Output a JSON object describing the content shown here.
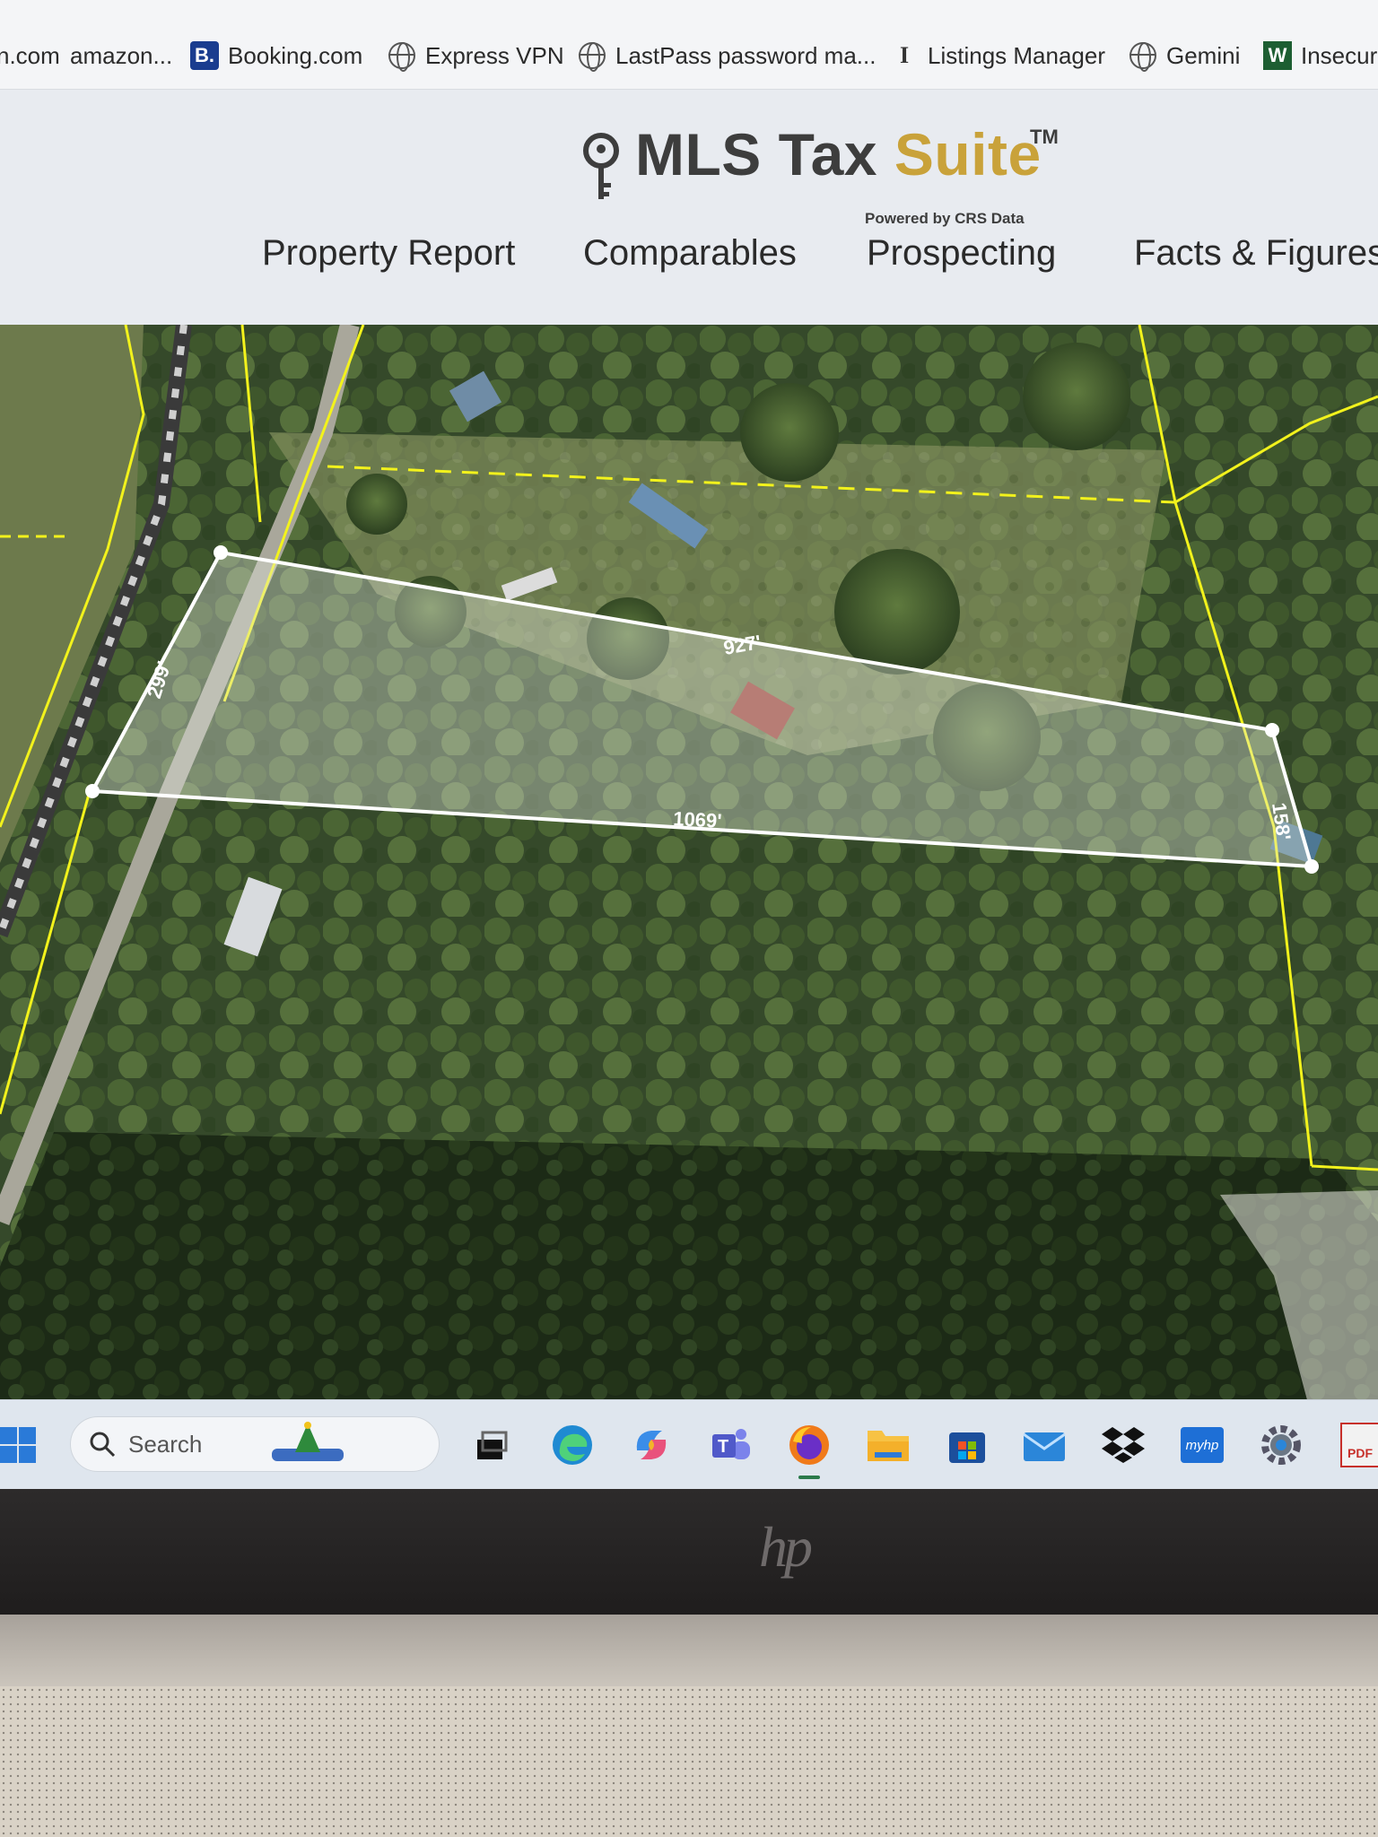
{
  "bookmarks": [
    {
      "label": "n.com",
      "icon": "none"
    },
    {
      "label": "amazon...",
      "icon": "none"
    },
    {
      "label": "Booking.com",
      "icon": "booking-icon",
      "glyph": "B."
    },
    {
      "label": "Express VPN",
      "icon": "globe-icon"
    },
    {
      "label": "LastPass password ma...",
      "icon": "globe-icon"
    },
    {
      "label": "Listings Manager",
      "icon": "listings-manager-icon",
      "glyph": "I"
    },
    {
      "label": "Gemini",
      "icon": "globe-icon"
    },
    {
      "label": "Insecuri",
      "icon": "w-icon",
      "glyph": "W"
    }
  ],
  "app": {
    "logo_main": "MLS Tax ",
    "logo_accent": "Suite",
    "logo_tm": "TM",
    "logo_sub": "Powered by CRS Data",
    "nav": [
      "Property Report",
      "Comparables",
      "Prospecting",
      "Facts & Figures"
    ]
  },
  "map": {
    "parcel_sides": {
      "north": "927'",
      "south": "1069'",
      "west": "299'",
      "east": "158'"
    },
    "colors": {
      "parcel_line": "#ffffff",
      "neighbor_lines": "#f2f21c"
    }
  },
  "taskbar": {
    "search_placeholder": "Search",
    "apps": [
      "widgets-icon",
      "task-view-icon",
      "edge-icon",
      "copilot-icon",
      "teams-icon",
      "firefox-icon",
      "file-explorer-icon",
      "store-icon",
      "mail-icon",
      "dropbox-icon",
      "myhp-icon",
      "settings-icon",
      "pdf-icon"
    ],
    "myhp_label": "myhp",
    "pdf_label": "PDF"
  },
  "laptop": {
    "brand": "hp"
  }
}
